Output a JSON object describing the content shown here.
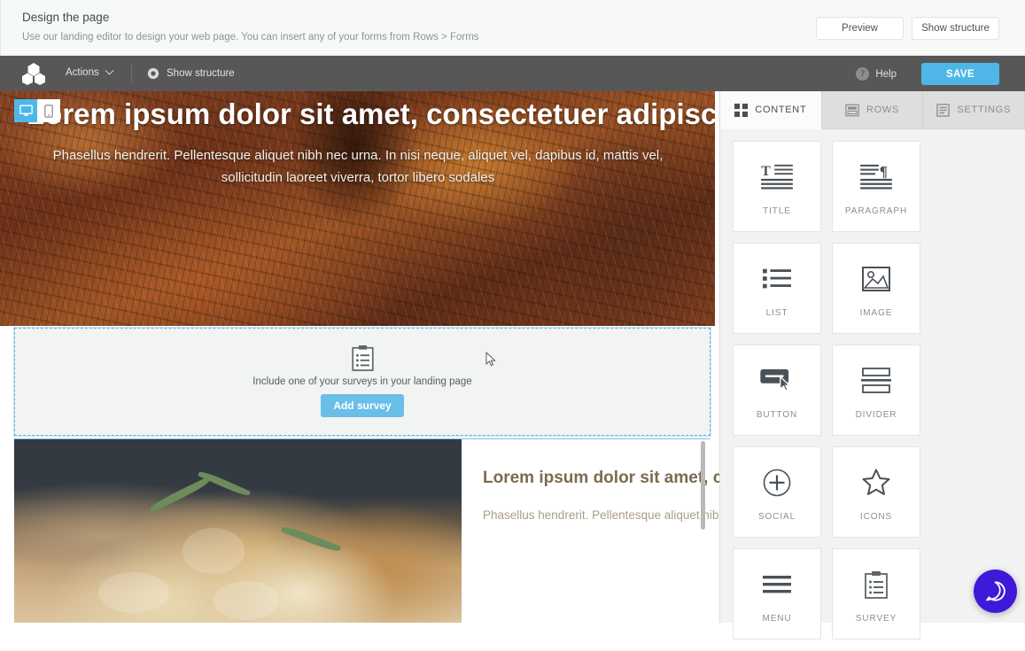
{
  "page_header": {
    "title": "Design the page",
    "subtitle": "Use our landing editor to design your web page. You can insert any of your forms from Rows > Forms",
    "preview_label": "Preview",
    "show_structure_label": "Show structure"
  },
  "toolbar": {
    "actions_label": "Actions",
    "show_structure_label": "Show structure",
    "help_label": "Help",
    "help_glyph": "?",
    "save_label": "SAVE",
    "save_color": "#4eb7e8",
    "background_color": "#575757"
  },
  "device_toggle": {
    "desktop": "desktop-view",
    "mobile": "mobile-view",
    "active": "desktop",
    "active_color": "#4eb7e8"
  },
  "canvas": {
    "hero": {
      "heading": "Lorem ipsum dolor sit amet, consectetuer adipiscing elit",
      "paragraph": "Phasellus hendrerit. Pellentesque aliquet nibh nec urna. In nisi neque, aliquet vel, dapibus id, mattis vel, sollicitudin laoreet viverra, tortor libero sodales"
    },
    "survey_block": {
      "icon": "survey-clipboard-icon",
      "caption": "Include one of your surveys in your landing page",
      "button_label": "Add survey",
      "button_color": "#69bfe8",
      "border_color": "#5bb3e0"
    },
    "content_row": {
      "image_alt": "sliced-bread-with-rosemary",
      "heading": "Lorem ipsum dolor sit amet, consectetur adipiscing elit.",
      "heading_color": "#7d6a4f",
      "body": "Phasellus hendrerit. Pellentesque aliquet nibh nec urna."
    }
  },
  "panel": {
    "tabs": [
      {
        "label": "CONTENT",
        "icon": "grid-icon",
        "active": true
      },
      {
        "label": "ROWS",
        "icon": "rows-icon",
        "active": false
      },
      {
        "label": "SETTINGS",
        "icon": "settings-document-icon",
        "active": false
      }
    ],
    "tiles": [
      {
        "label": "TITLE",
        "icon": "title-icon"
      },
      {
        "label": "PARAGRAPH",
        "icon": "paragraph-icon"
      },
      {
        "label": "LIST",
        "icon": "list-icon"
      },
      {
        "label": "IMAGE",
        "icon": "image-icon"
      },
      {
        "label": "BUTTON",
        "icon": "button-icon"
      },
      {
        "label": "DIVIDER",
        "icon": "divider-icon"
      },
      {
        "label": "SOCIAL",
        "icon": "social-plus-icon"
      },
      {
        "label": "ICONS",
        "icon": "star-icon"
      },
      {
        "label": "MENU",
        "icon": "menu-hamburger-icon"
      },
      {
        "label": "SURVEY",
        "icon": "survey-clipboard-icon"
      }
    ]
  },
  "chat": {
    "icon": "chat-bubble-icon",
    "color": "#3f19d9"
  }
}
